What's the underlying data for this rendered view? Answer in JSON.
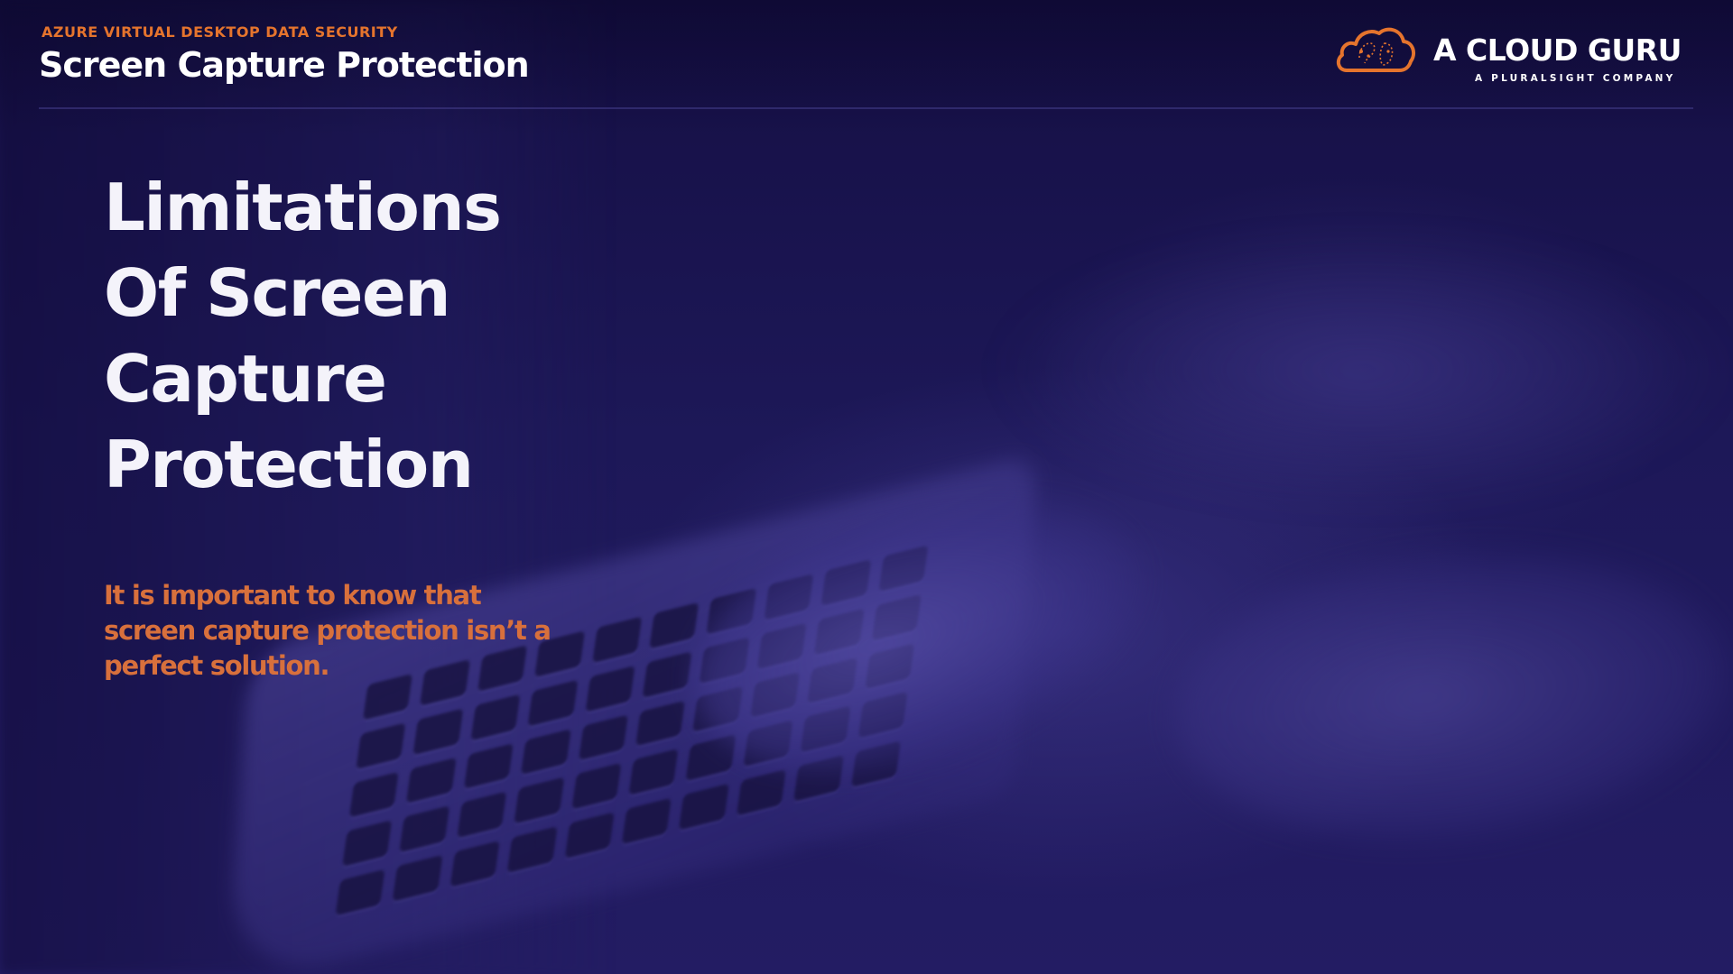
{
  "header": {
    "eyebrow": "AZURE VIRTUAL DESKTOP DATA SECURITY",
    "title": "Screen Capture Protection"
  },
  "logo": {
    "icon": "cloud-icon",
    "name": "A CLOUD GURU",
    "tagline": "A PLURALSIGHT COMPANY"
  },
  "slide": {
    "heading_lines": [
      "Limitations",
      "Of Screen",
      "Capture",
      "Protection"
    ],
    "callout": "It is important to know that screen capture protection isn’t a perfect solution."
  },
  "colors": {
    "background": "#1b1650",
    "accent_orange": "#e5742d",
    "callout_orange": "#d8703c",
    "heading_white": "#f4f3fa"
  }
}
